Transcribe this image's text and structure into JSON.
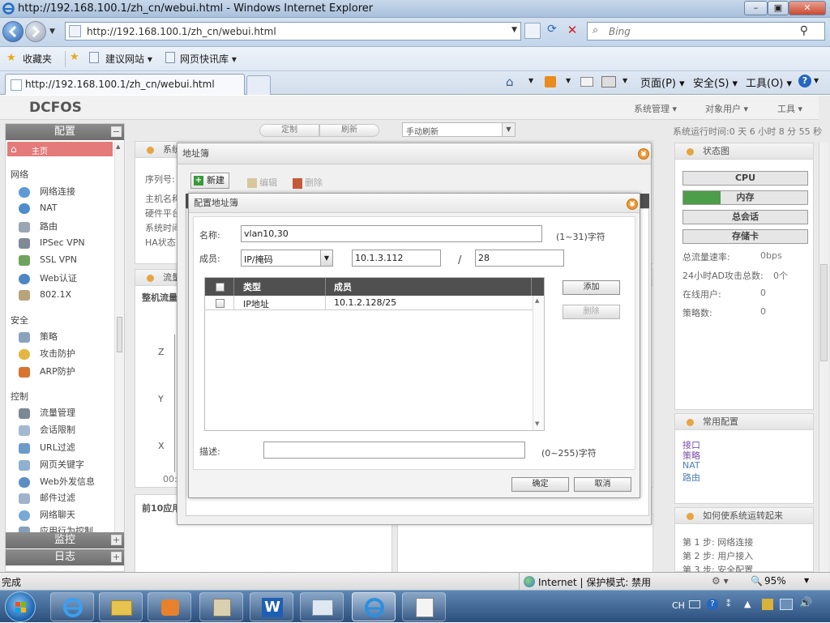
{
  "browser": {
    "title": "http://192.168.100.1/zh_cn/webui.html - Windows Internet Explorer",
    "url": "http://192.168.100.1/zh_cn/webui.html",
    "search_placeholder": "Bing",
    "favorites_label": "收藏夹",
    "fav_links": [
      "建议网站",
      "网页快讯库"
    ],
    "tab_title": "http://192.168.100.1/zh_cn/webui.html",
    "cmd_menus": [
      "页面(P)",
      "安全(S)",
      "工具(O)"
    ]
  },
  "app": {
    "logo": "DCFOS",
    "top_menus": [
      "系统管理",
      "对象用户",
      "工具"
    ],
    "toolbar": {
      "btn1": "定制",
      "btn2": "刷新",
      "refresh_mode": "手动刷新"
    },
    "uptime": "系统运行时间:0 天 6 小时 8 分 55 秒"
  },
  "sidebar": {
    "header": "配置",
    "home": "主页",
    "groups": [
      {
        "name": "网络",
        "items": [
          "网络连接",
          "NAT",
          "路由",
          "IPSec VPN",
          "SSL VPN",
          "Web认证",
          "802.1X"
        ]
      },
      {
        "name": "安全",
        "items": [
          "策略",
          "攻击防护",
          "ARP防护"
        ]
      },
      {
        "name": "控制",
        "items": [
          "流量管理",
          "会话限制",
          "URL过滤",
          "网页关键字",
          "Web外发信息",
          "邮件过滤",
          "网络聊天",
          "应用行为控制"
        ]
      }
    ],
    "footer1": "监控",
    "footer2": "日志"
  },
  "background": {
    "sys_panel_title": "系统",
    "sys_labels": [
      "序列号:",
      "主机名称",
      "硬件平台",
      "系统时间",
      "HA状态:"
    ],
    "flow_title": "流量",
    "flow_sub": "整机流量",
    "axis": [
      "Z",
      "Y",
      "X"
    ],
    "axis_time": "00:0",
    "top10": "前10应用"
  },
  "status_panel": {
    "title": "状态图",
    "boxes": [
      "CPU",
      "内存",
      "总会话",
      "存储卡"
    ],
    "memory_fraction": 0.3,
    "rows": [
      {
        "label": "总流量速率:",
        "value": "0bps"
      },
      {
        "label": "24小时AD攻击总数:",
        "value": "0个"
      },
      {
        "label": "在线用户:",
        "value": "0"
      },
      {
        "label": "策略数:",
        "value": "0"
      }
    ]
  },
  "common_panel": {
    "title": "常用配置",
    "links": [
      "接口",
      "策略",
      "NAT",
      "路由"
    ]
  },
  "howto_panel": {
    "title": "如何使系统运转起来",
    "steps": [
      "第 1 步: 网络连接",
      "第 2 步: 用户接入",
      "第 3 步: 安全配置"
    ]
  },
  "dialog_outer": {
    "title": "地址簿",
    "new_btn": "新建",
    "edit_btn": "编辑",
    "delete_btn": "删除"
  },
  "dialog": {
    "title": "配置地址簿",
    "name_label": "名称:",
    "name_value": "vlan10,30",
    "name_hint": "(1~31)字符",
    "member_label": "成员:",
    "member_type": "IP/掩码",
    "ip_value": "10.1.3.112",
    "slash": "/",
    "mask_value": "28",
    "table_headers": [
      "类型",
      "成员"
    ],
    "rows": [
      {
        "type": "IP地址",
        "member": "10.1.2.128/25"
      }
    ],
    "add_btn": "添加",
    "del_btn": "删除",
    "desc_label": "描述:",
    "desc_hint": "(0~255)字符",
    "ok_btn": "确定",
    "cancel_btn": "取消"
  },
  "statusbar": {
    "left": "完成",
    "zone": "Internet | 保护模式: 禁用",
    "zoom": "95%"
  },
  "tray": {
    "lang": "CH"
  }
}
